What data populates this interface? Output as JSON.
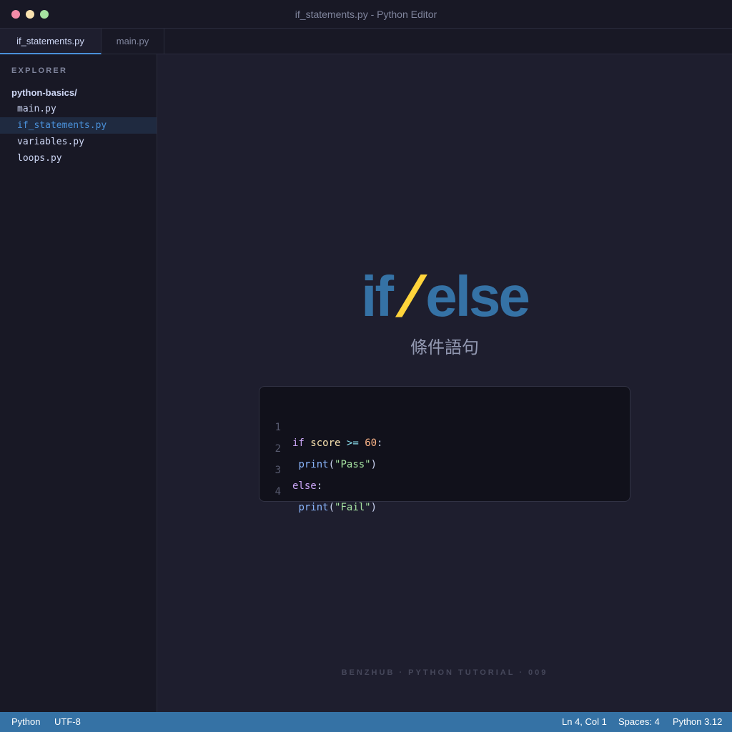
{
  "window": {
    "title": "if_statements.py - Python Editor"
  },
  "tabs": [
    {
      "label": "if_statements.py",
      "active": true
    },
    {
      "label": "main.py",
      "active": false
    }
  ],
  "sidebar": {
    "header": "EXPLORER",
    "folder": "python-basics/",
    "files": [
      {
        "name": "main.py",
        "active": false
      },
      {
        "name": "if_statements.py",
        "active": true
      },
      {
        "name": "variables.py",
        "active": false
      },
      {
        "name": "loops.py",
        "active": false
      }
    ]
  },
  "hero": {
    "keyword_if": "if",
    "slash": "/",
    "keyword_else": "else",
    "subtitle": "條件語句"
  },
  "code": {
    "lines": [
      {
        "number": "1",
        "tokens": [
          "if",
          "score",
          ">=",
          "60",
          ":"
        ]
      },
      {
        "number": "2",
        "tokens": [
          "print",
          "(",
          "\"Pass\"",
          ")"
        ]
      },
      {
        "number": "3",
        "tokens": [
          "else",
          ":"
        ]
      },
      {
        "number": "4",
        "tokens": [
          "print",
          "(",
          "\"Fail\"",
          ")"
        ]
      }
    ]
  },
  "footer": "BENZHUB · PYTHON TUTORIAL · 009",
  "statusbar": {
    "language": "Python",
    "encoding": "UTF-8",
    "position": "Ln 4, Col 1",
    "indent": "Spaces: 4",
    "interpreter": "Python 3.12"
  },
  "colors": {
    "accent": "#3572a5",
    "highlight": "#ffd43b",
    "background": "#1e1e2e"
  }
}
